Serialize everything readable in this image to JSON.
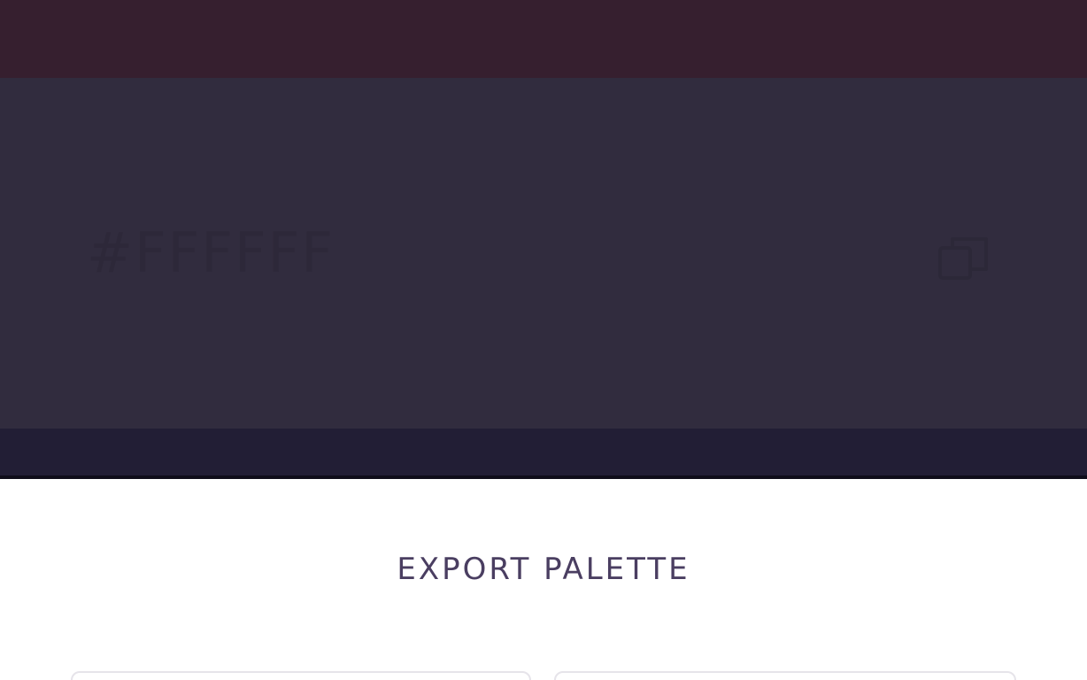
{
  "palette": {
    "colors": {
      "top_swatch": "#361f2f",
      "main_swatch": "#312c3e",
      "bottom_swatch": "#221e35"
    },
    "active_swatch": {
      "hex_label": "#FFFFFF",
      "copy_icon": "copy-icon"
    }
  },
  "export": {
    "title": "EXPORT PALETTE",
    "options": [
      "",
      ""
    ]
  }
}
